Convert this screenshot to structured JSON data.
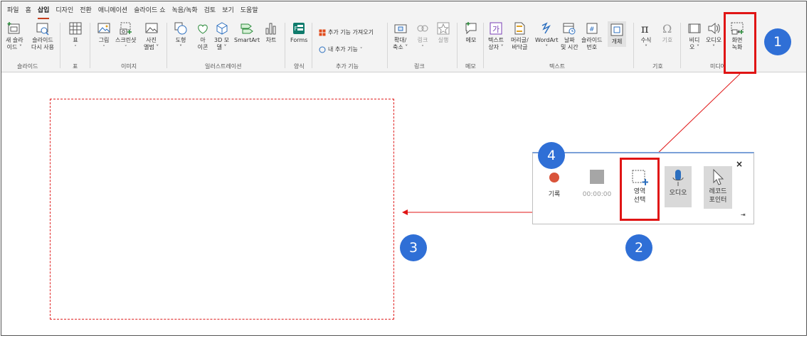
{
  "ribbon": {
    "tabs": [
      "파일",
      "홈",
      "삽입",
      "디자인",
      "전환",
      "애니메이션",
      "슬라이드 쇼",
      "녹음/녹화",
      "검토",
      "보기",
      "도움말"
    ],
    "active_tab": "삽입",
    "slides": {
      "new_slide": {
        "line1": "새 슬라",
        "line2": "이드 ˅"
      },
      "reuse_slide": {
        "line1": "슬라이드",
        "line2": "다시 사용"
      },
      "group": "슬라이드"
    },
    "table": {
      "label": "표",
      "caret": "˅",
      "group": "표"
    },
    "images": {
      "picture": "그림",
      "screenshot": "스크린샷",
      "photo_album": {
        "line1": "사진",
        "line2": "앨범 ˅"
      },
      "caret": "˅",
      "group": "이미지"
    },
    "illustrations": {
      "shapes": {
        "line1": "도형",
        "line2": "˅"
      },
      "icons": {
        "line1": "아",
        "line2": "이콘"
      },
      "models3d": {
        "line1": "3D 모",
        "line2": "델 ˅"
      },
      "smartart": "SmartArt",
      "chart": "차트",
      "group": "일러스트레이션"
    },
    "forms": {
      "label": "Forms",
      "group": "양식"
    },
    "addins": {
      "get": "추가 기능 가져오기",
      "my": "내 추가 기능",
      "caret": "˅",
      "group": "추가 기능"
    },
    "links": {
      "zoom": {
        "line1": "확대/",
        "line2": "축소 ˅"
      },
      "link": "링크",
      "action": "실행",
      "group": "링크"
    },
    "comments": {
      "label": "메모",
      "group": "메모"
    },
    "text": {
      "textbox": {
        "line1": "텍스트",
        "line2": "상자 ˅"
      },
      "header": {
        "line1": "머리글/",
        "line2": "바닥글"
      },
      "wordart": {
        "line1": "WordArt",
        "line2": "˅"
      },
      "datetime": {
        "line1": "날짜",
        "line2": "및 시간"
      },
      "slidenum": {
        "line1": "슬라이드",
        "line2": "번호"
      },
      "object": "개체",
      "group": "텍스트"
    },
    "symbols": {
      "equation": {
        "line1": "수식",
        "line2": "˅"
      },
      "symbol": "기호",
      "group": "기호"
    },
    "media": {
      "video": {
        "line1": "비디",
        "line2": "오 ˅"
      },
      "audio": {
        "line1": "오디오",
        "line2": "˅"
      },
      "screen_rec": {
        "line1": "화면",
        "line2": "녹화"
      },
      "group": "미디어"
    }
  },
  "recorder": {
    "record": "기록",
    "timer": "00:00:00",
    "select_area": {
      "line1": "영역",
      "line2": "선택"
    },
    "audio": "오디오",
    "pointer": {
      "line1": "레코드",
      "line2": "포인터"
    },
    "close": "×",
    "pin": "⇥"
  },
  "badges": {
    "b1": "1",
    "b2": "2",
    "b3": "3",
    "b4": "4"
  },
  "colors": {
    "accent_red": "#e01515",
    "badge_blue": "#2f6fd6",
    "ribbon_bg": "#f3f3f3"
  }
}
